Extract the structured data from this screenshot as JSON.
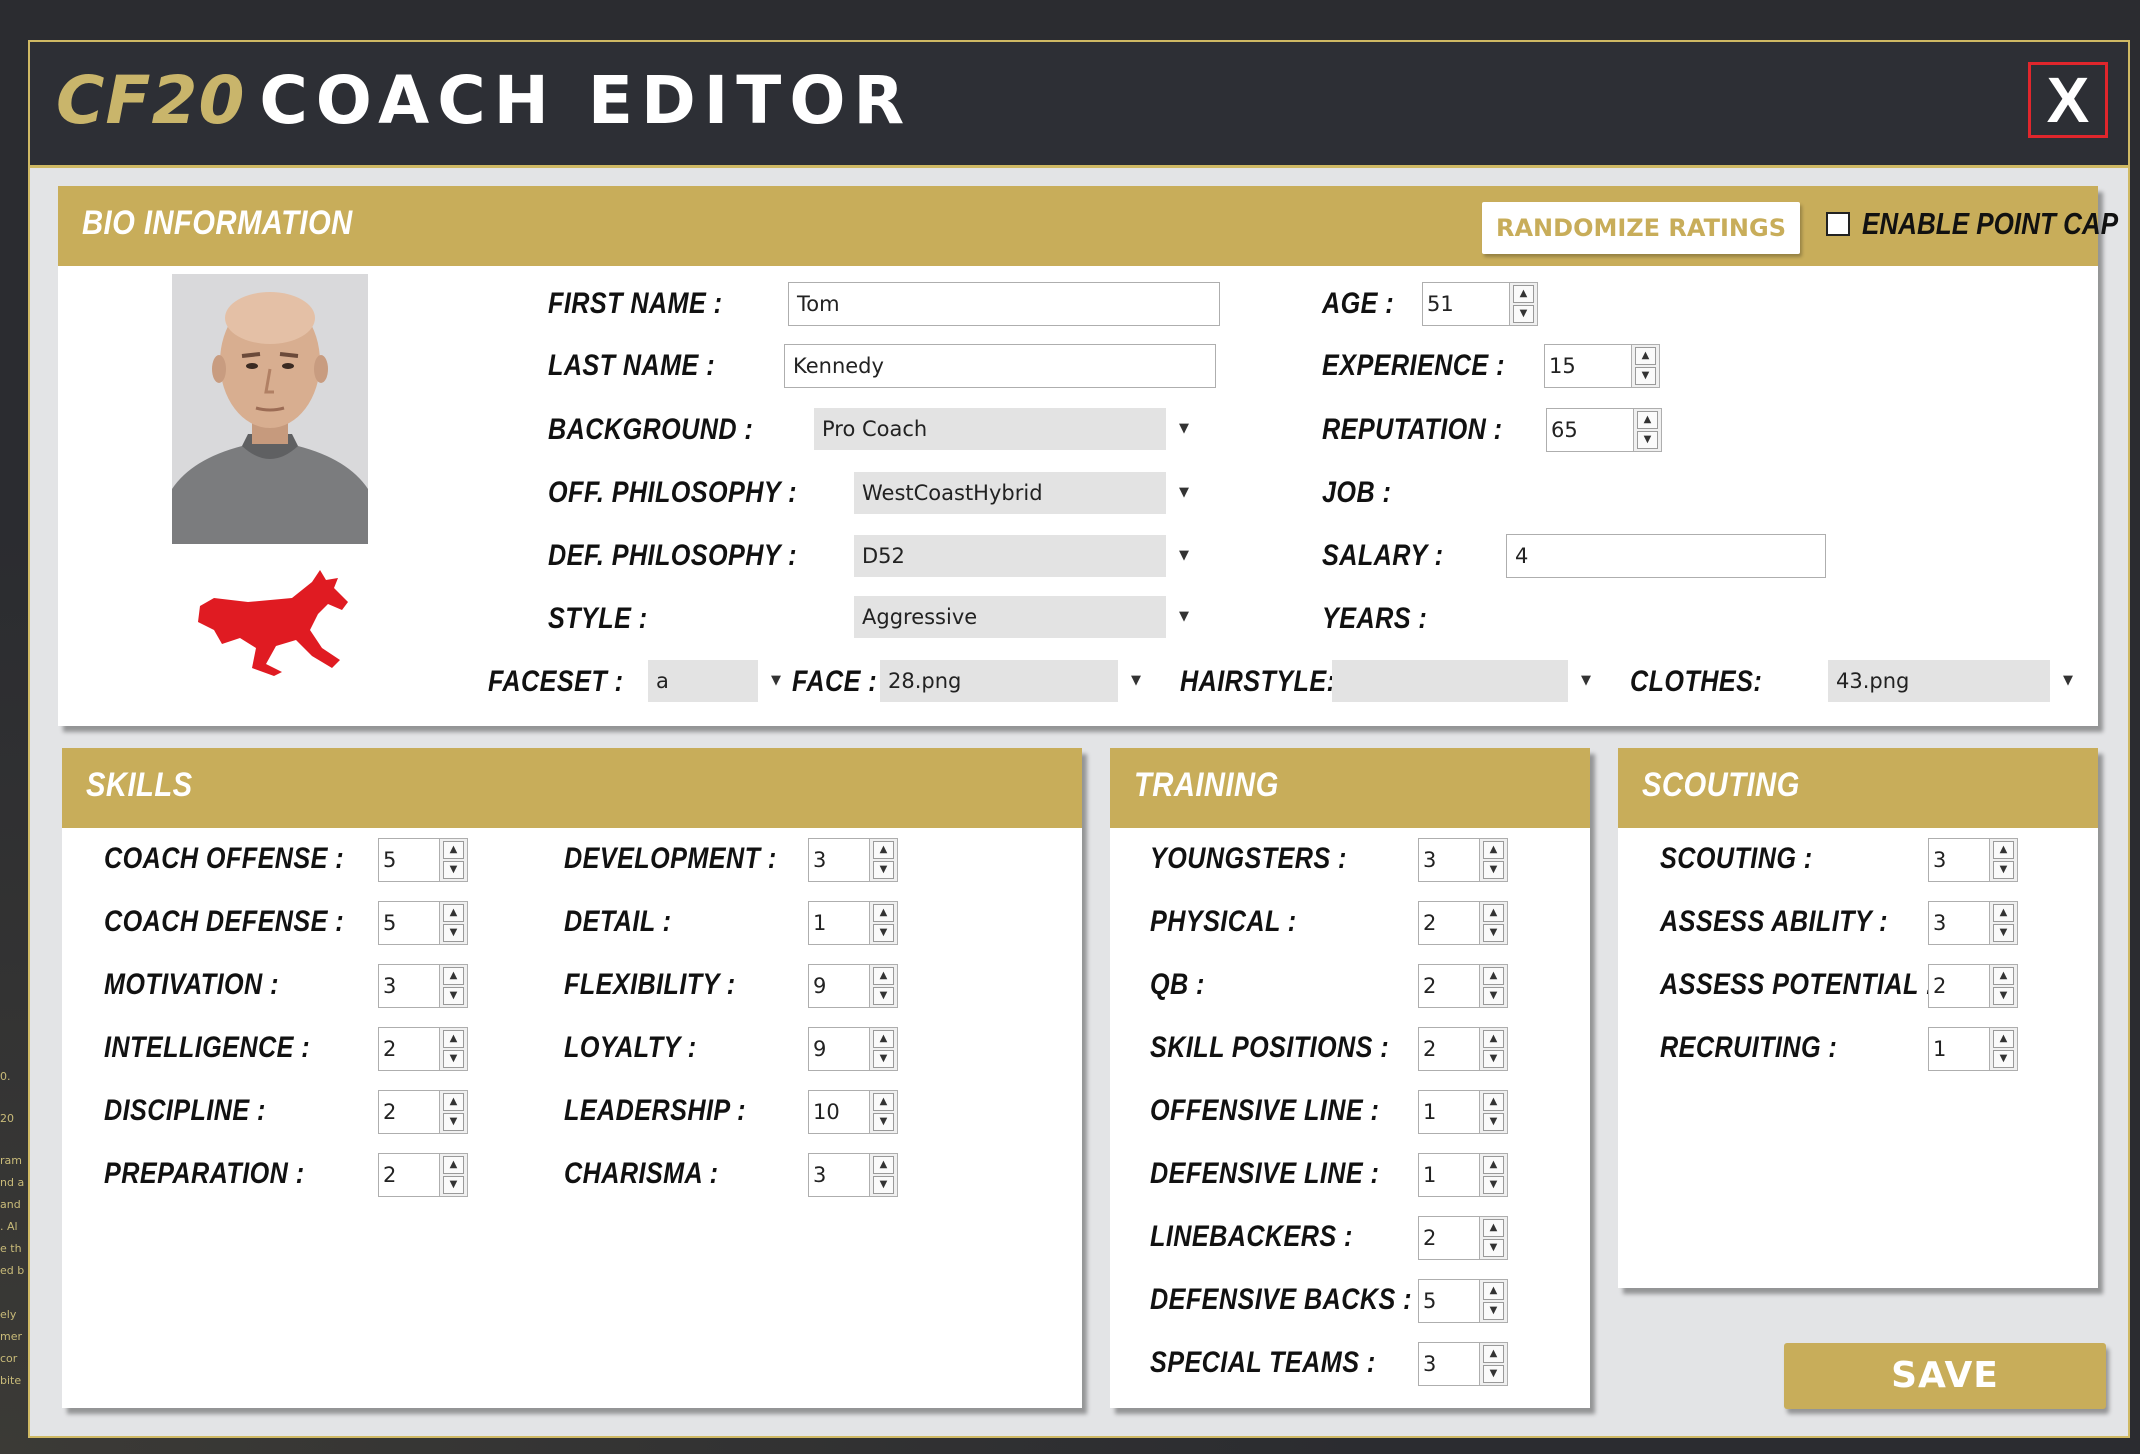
{
  "window": {
    "title_prefix": "CF20",
    "title": "COACH EDITOR",
    "close_label": "X"
  },
  "bio": {
    "header": "BIO INFORMATION",
    "randomize_label": "RANDOMIZE RATINGS",
    "point_cap_label": "ENABLE POINT CAP",
    "first_name_label": "FIRST NAME :",
    "first_name": "Tom",
    "last_name_label": "LAST NAME :",
    "last_name": "Kennedy",
    "background_label": "BACKGROUND :",
    "background": "Pro Coach",
    "off_label": "OFF. PHILOSOPHY :",
    "off": "WestCoastHybrid",
    "def_label": "DEF. PHILOSOPHY :",
    "def": "D52",
    "style_label": "STYLE :",
    "style": "Aggressive",
    "age_label": "AGE :",
    "age": "51",
    "experience_label": "EXPERIENCE :",
    "experience": "15",
    "reputation_label": "REPUTATION :",
    "reputation": "65",
    "job_label": "JOB :",
    "salary_label": "SALARY :",
    "salary": "4",
    "years_label": "YEARS :",
    "faceset_label": "FACESET :",
    "faceset": "a",
    "face_label": "FACE :",
    "face": "28.png",
    "hairstyle_label": "HAIRSTYLE:",
    "hairstyle": "",
    "clothes_label": "CLOTHES:",
    "clothes": "43.png"
  },
  "skills": {
    "header": "SKILLS",
    "left": [
      {
        "label": "COACH OFFENSE :",
        "value": "5"
      },
      {
        "label": "COACH DEFENSE :",
        "value": "5"
      },
      {
        "label": "MOTIVATION :",
        "value": "3"
      },
      {
        "label": "INTELLIGENCE :",
        "value": "2"
      },
      {
        "label": "DISCIPLINE :",
        "value": "2"
      },
      {
        "label": "PREPARATION :",
        "value": "2"
      }
    ],
    "right": [
      {
        "label": "DEVELOPMENT :",
        "value": "3"
      },
      {
        "label": "DETAIL :",
        "value": "1"
      },
      {
        "label": "FLEXIBILITY :",
        "value": "9"
      },
      {
        "label": "LOYALTY :",
        "value": "9"
      },
      {
        "label": "LEADERSHIP :",
        "value": "10"
      },
      {
        "label": "CHARISMA :",
        "value": "3"
      }
    ]
  },
  "training": {
    "header": "TRAINING",
    "items": [
      {
        "label": "YOUNGSTERS :",
        "value": "3"
      },
      {
        "label": "PHYSICAL :",
        "value": "2"
      },
      {
        "label": "QB :",
        "value": "2"
      },
      {
        "label": "SKILL POSITIONS :",
        "value": "2"
      },
      {
        "label": "OFFENSIVE LINE :",
        "value": "1"
      },
      {
        "label": "DEFENSIVE LINE :",
        "value": "1"
      },
      {
        "label": "LINEBACKERS :",
        "value": "2"
      },
      {
        "label": "DEFENSIVE BACKS :",
        "value": "5"
      },
      {
        "label": "SPECIAL TEAMS :",
        "value": "3"
      }
    ]
  },
  "scouting": {
    "header": "SCOUTING",
    "items": [
      {
        "label": "SCOUTING :",
        "value": "3"
      },
      {
        "label": "ASSESS ABILITY :",
        "value": "3"
      },
      {
        "label": "ASSESS POTENTIAL :",
        "value": "2"
      },
      {
        "label": "RECRUITING :",
        "value": "1"
      }
    ]
  },
  "save_label": "SAVE",
  "background_text": [
    "0.",
    "20",
    "ram",
    "nd a",
    "and",
    ". Al",
    "e th",
    "ed b",
    "",
    "ely",
    "mer",
    "cor",
    "bite"
  ],
  "colors": {
    "gold": "#c8ad5a",
    "dark": "#2d2f35",
    "close_red": "#e0262c",
    "logo_red": "#e01b22"
  }
}
